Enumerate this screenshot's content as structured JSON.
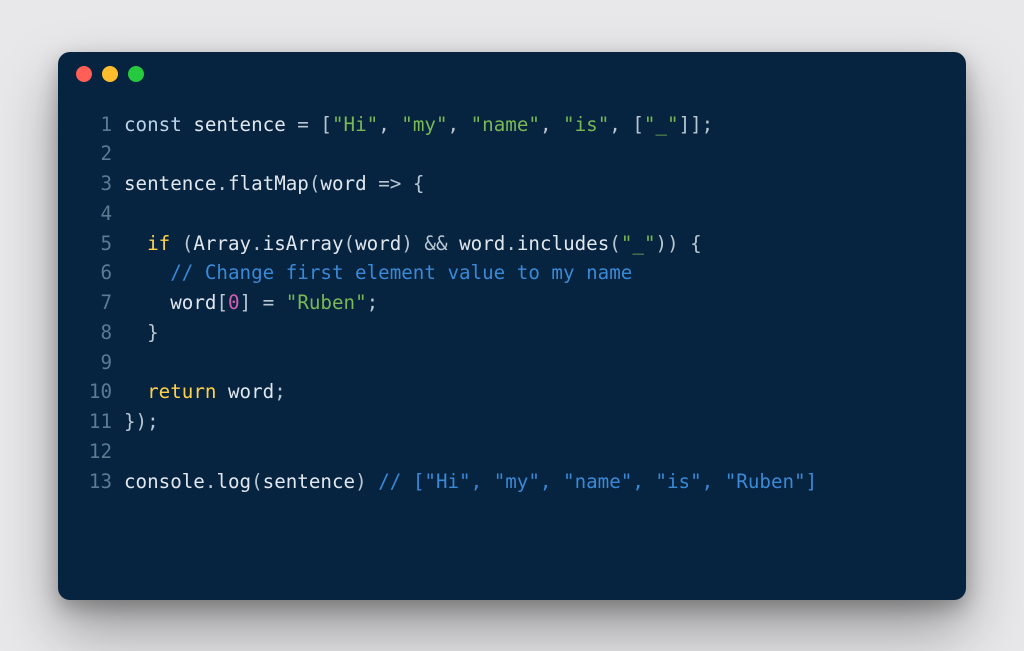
{
  "traffic_lights": [
    "red",
    "yellow",
    "green"
  ],
  "code": {
    "lines": [
      {
        "n": "1",
        "tokens": [
          {
            "t": "const",
            "c": "kw"
          },
          {
            "t": " ",
            "c": "punct"
          },
          {
            "t": "sentence",
            "c": "ident"
          },
          {
            "t": " = [",
            "c": "punct"
          },
          {
            "t": "\"Hi\"",
            "c": "str"
          },
          {
            "t": ", ",
            "c": "punct"
          },
          {
            "t": "\"my\"",
            "c": "str"
          },
          {
            "t": ", ",
            "c": "punct"
          },
          {
            "t": "\"name\"",
            "c": "str"
          },
          {
            "t": ", ",
            "c": "punct"
          },
          {
            "t": "\"is\"",
            "c": "str"
          },
          {
            "t": ", [",
            "c": "punct"
          },
          {
            "t": "\"_\"",
            "c": "str"
          },
          {
            "t": "]];",
            "c": "punct"
          }
        ]
      },
      {
        "n": "2",
        "tokens": []
      },
      {
        "n": "3",
        "tokens": [
          {
            "t": "sentence",
            "c": "ident"
          },
          {
            "t": ".",
            "c": "punct"
          },
          {
            "t": "flatMap",
            "c": "call"
          },
          {
            "t": "(",
            "c": "punct"
          },
          {
            "t": "word",
            "c": "ident"
          },
          {
            "t": " => {",
            "c": "punct"
          }
        ]
      },
      {
        "n": "4",
        "tokens": []
      },
      {
        "n": "5",
        "tokens": [
          {
            "t": "  ",
            "c": "punct"
          },
          {
            "t": "if",
            "c": "ret"
          },
          {
            "t": " (",
            "c": "punct"
          },
          {
            "t": "Array",
            "c": "ident"
          },
          {
            "t": ".",
            "c": "punct"
          },
          {
            "t": "isArray",
            "c": "call"
          },
          {
            "t": "(",
            "c": "punct"
          },
          {
            "t": "word",
            "c": "ident"
          },
          {
            "t": ") ",
            "c": "punct"
          },
          {
            "t": "&&",
            "c": "op"
          },
          {
            "t": " ",
            "c": "punct"
          },
          {
            "t": "word",
            "c": "ident"
          },
          {
            "t": ".",
            "c": "punct"
          },
          {
            "t": "includes",
            "c": "call"
          },
          {
            "t": "(",
            "c": "punct"
          },
          {
            "t": "\"_\"",
            "c": "str"
          },
          {
            "t": ")) {",
            "c": "punct"
          }
        ]
      },
      {
        "n": "6",
        "tokens": [
          {
            "t": "    ",
            "c": "punct"
          },
          {
            "t": "// Change first element value to my name",
            "c": "comm"
          }
        ]
      },
      {
        "n": "7",
        "tokens": [
          {
            "t": "    ",
            "c": "punct"
          },
          {
            "t": "word",
            "c": "ident"
          },
          {
            "t": "[",
            "c": "punct"
          },
          {
            "t": "0",
            "c": "num"
          },
          {
            "t": "] = ",
            "c": "punct"
          },
          {
            "t": "\"Ruben\"",
            "c": "str"
          },
          {
            "t": ";",
            "c": "punct"
          }
        ]
      },
      {
        "n": "8",
        "tokens": [
          {
            "t": "  }",
            "c": "punct"
          }
        ]
      },
      {
        "n": "9",
        "tokens": []
      },
      {
        "n": "10",
        "tokens": [
          {
            "t": "  ",
            "c": "punct"
          },
          {
            "t": "return",
            "c": "ret"
          },
          {
            "t": " ",
            "c": "punct"
          },
          {
            "t": "word",
            "c": "ident"
          },
          {
            "t": ";",
            "c": "punct"
          }
        ]
      },
      {
        "n": "11",
        "tokens": [
          {
            "t": "});",
            "c": "punct"
          }
        ]
      },
      {
        "n": "12",
        "tokens": []
      },
      {
        "n": "13",
        "tokens": [
          {
            "t": "console",
            "c": "ident"
          },
          {
            "t": ".",
            "c": "punct"
          },
          {
            "t": "log",
            "c": "call"
          },
          {
            "t": "(",
            "c": "punct"
          },
          {
            "t": "sentence",
            "c": "ident"
          },
          {
            "t": ") ",
            "c": "punct"
          },
          {
            "t": "// [\"Hi\", \"my\", \"name\", \"is\", \"Ruben\"]",
            "c": "comm"
          }
        ]
      }
    ]
  }
}
